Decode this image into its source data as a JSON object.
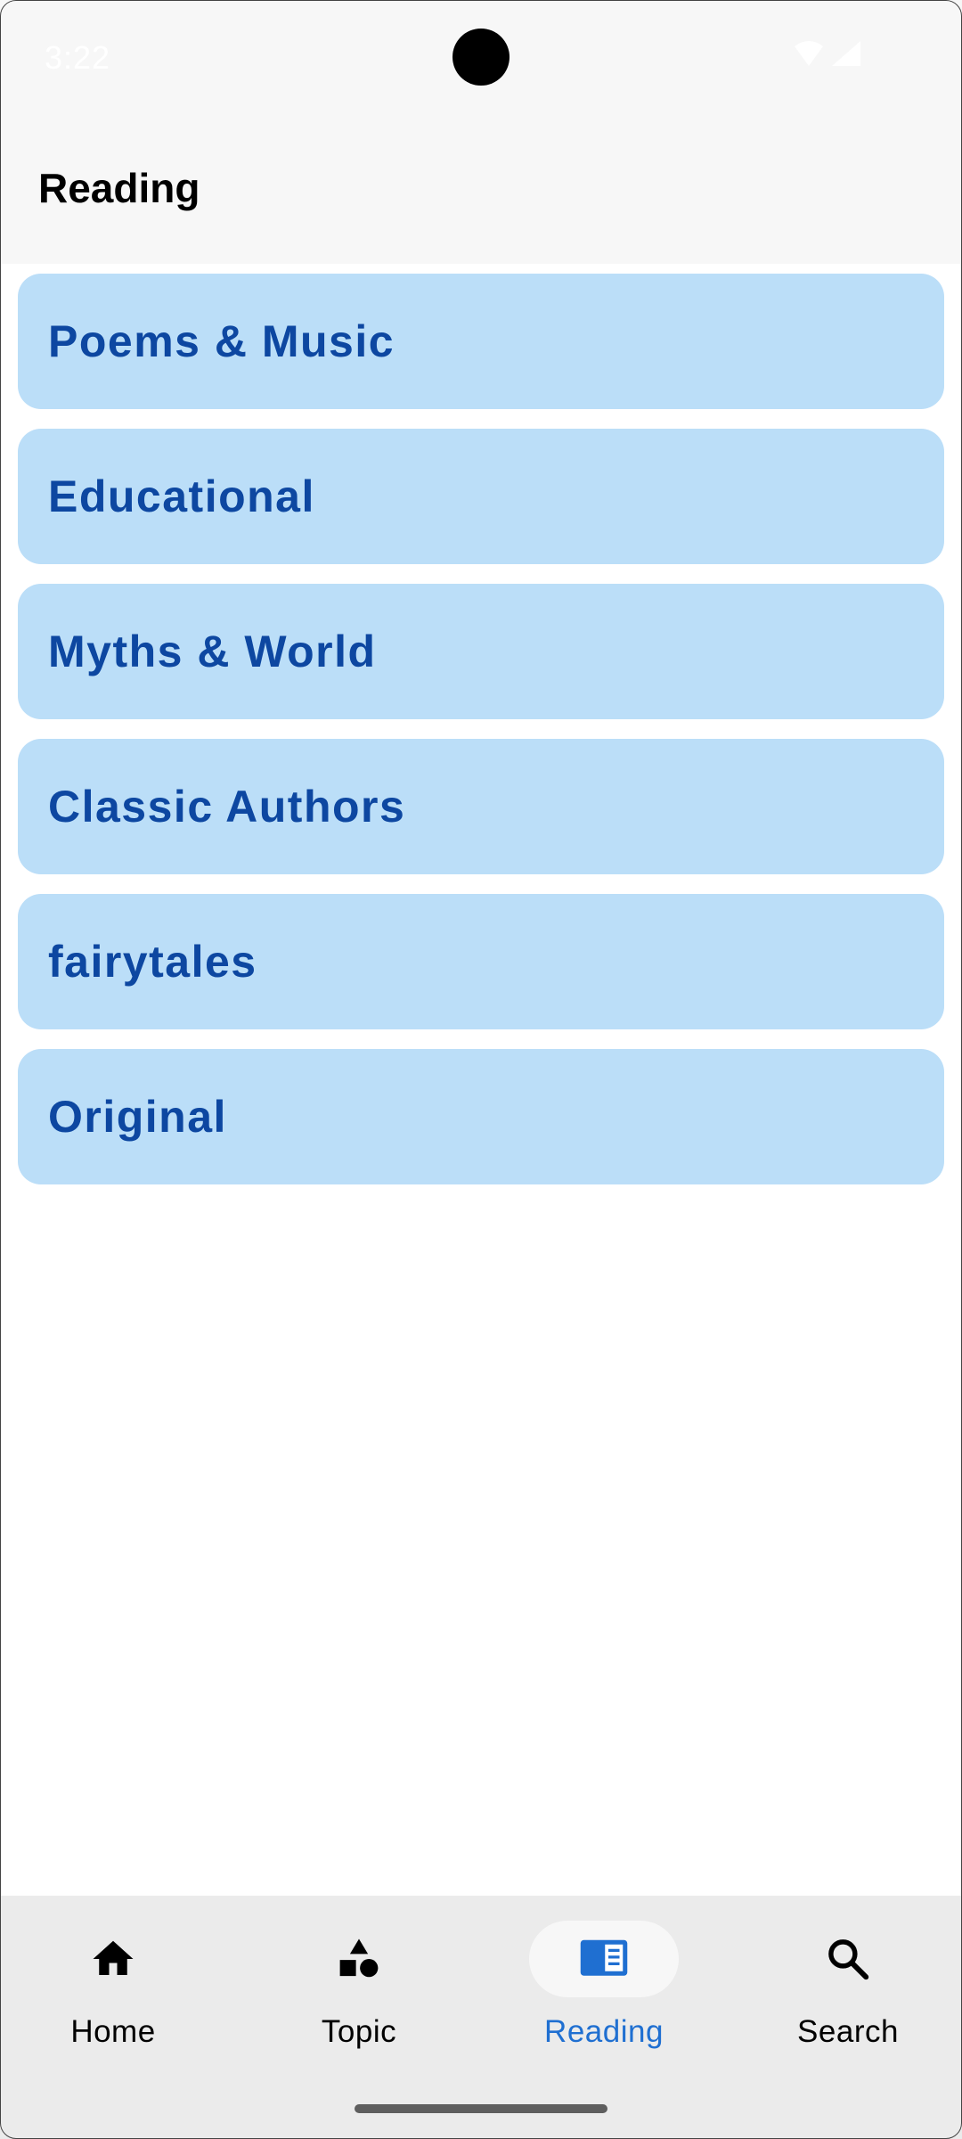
{
  "status_bar": {
    "time": "3:22",
    "icons": [
      "wifi-icon",
      "cellular-signal-icon"
    ]
  },
  "app_bar": {
    "title": "Reading"
  },
  "categories": [
    {
      "label": "Poems & Music"
    },
    {
      "label": "Educational"
    },
    {
      "label": "Myths & World"
    },
    {
      "label": "Classic Authors"
    },
    {
      "label": "fairytales"
    },
    {
      "label": "Original"
    }
  ],
  "bottom_nav": {
    "items": [
      {
        "label": "Home",
        "icon": "home-icon",
        "active": false
      },
      {
        "label": "Topic",
        "icon": "shapes-icon",
        "active": false
      },
      {
        "label": "Reading",
        "icon": "chrome-reader-icon",
        "active": true
      },
      {
        "label": "Search",
        "icon": "search-icon",
        "active": false
      }
    ]
  },
  "colors": {
    "item_background": "#bbdef8",
    "item_text": "#0d47a1",
    "active_nav": "#1f6fd1",
    "nav_background": "#ebebeb"
  }
}
